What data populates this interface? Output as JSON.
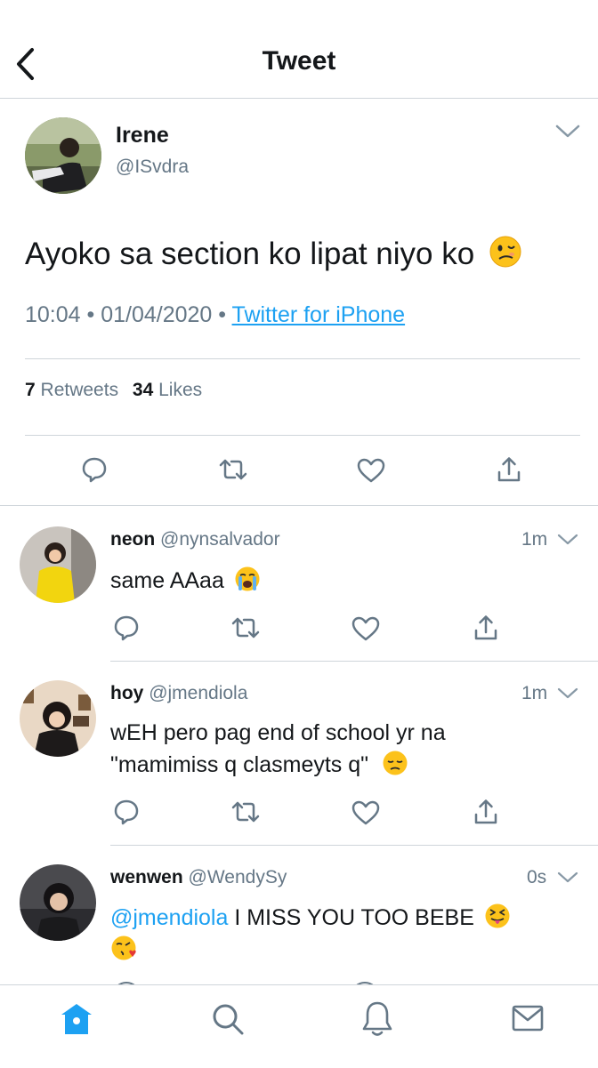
{
  "header": {
    "title": "Tweet",
    "back_icon": "chevron-left-icon"
  },
  "tweet": {
    "name": "Irene",
    "handle": "@ISvdra",
    "text": "Ayoko sa section ko lipat niyo ko",
    "emoji": "woozy-face",
    "time": "10:04",
    "date": "01/04/2020",
    "source": "Twitter for iPhone",
    "retweets_count": "7",
    "retweets_label": "Retweets",
    "likes_count": "34",
    "likes_label": "Likes"
  },
  "replies": [
    {
      "name": "neon",
      "handle": "@nynsalvador",
      "time": "1m",
      "text": "same AAaa",
      "emoji": "loudly-crying-face"
    },
    {
      "name": "hoy",
      "handle": "@jmendiola",
      "time": "1m",
      "text_line1": "wEH pero pag end of school yr na",
      "text_line2": "\"mamimiss q clasmeyts q\"",
      "emoji": "pensive-face"
    },
    {
      "name": "wenwen",
      "handle": "@WendySy",
      "time": "0s",
      "mention": "@jmendiola",
      "text": "I MISS YOU TOO BEBE",
      "emoji": [
        "squinting-tongue-face",
        "face-blowing-kiss"
      ]
    }
  ],
  "tabbar": {
    "items": [
      "home-icon",
      "search-icon",
      "bell-icon",
      "mail-icon"
    ],
    "active": "home-icon"
  },
  "colors": {
    "accent": "#1da1f2",
    "text": "#14171a",
    "muted": "#657786",
    "divider": "#cfd5da"
  }
}
